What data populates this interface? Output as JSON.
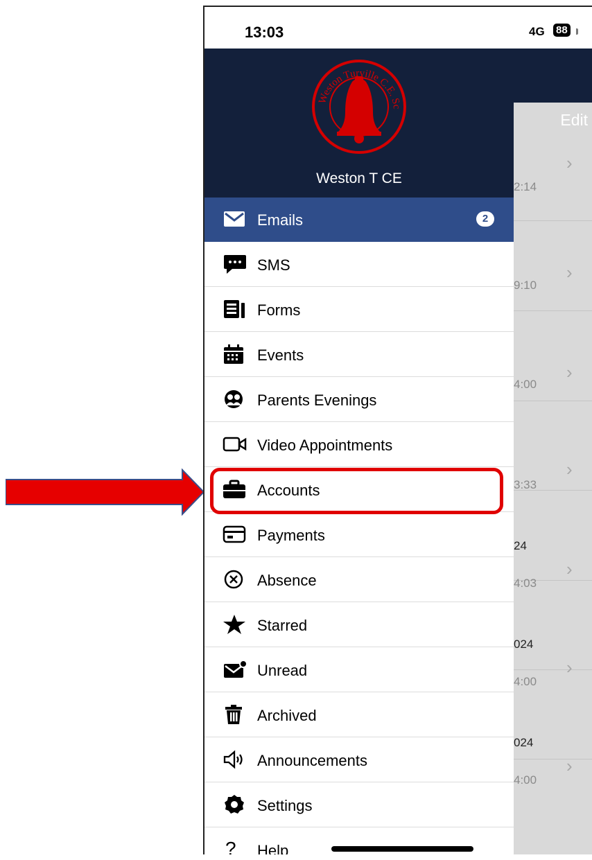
{
  "status_bar": {
    "time": "13:03",
    "network": "4G",
    "battery": "88"
  },
  "background_screen": {
    "edit_label": "Edit",
    "rows": [
      {
        "date": "",
        "time": "2:14"
      },
      {
        "date": "",
        "time": "9:10"
      },
      {
        "date": "",
        "time": "4:00"
      },
      {
        "date": "",
        "time": "3:33"
      },
      {
        "date": "24",
        "time": "4:03"
      },
      {
        "date": "024",
        "time": "4:00"
      },
      {
        "date": "024",
        "time": "4:00"
      }
    ],
    "chevron": "›"
  },
  "drawer": {
    "school_name": "Weston T CE",
    "logo_text": "Weston Turville C.E. School",
    "items": [
      {
        "label": "Emails",
        "icon": "mail-icon",
        "badge": "2",
        "active": true
      },
      {
        "label": "SMS",
        "icon": "chat-bubble-icon"
      },
      {
        "label": "Forms",
        "icon": "form-icon"
      },
      {
        "label": "Events",
        "icon": "calendar-icon"
      },
      {
        "label": "Parents Evenings",
        "icon": "people-icon"
      },
      {
        "label": "Video Appointments",
        "icon": "video-camera-icon"
      },
      {
        "label": "Accounts",
        "icon": "briefcase-icon"
      },
      {
        "label": "Payments",
        "icon": "credit-card-icon"
      },
      {
        "label": "Absence",
        "icon": "x-circle-icon"
      },
      {
        "label": "Starred",
        "icon": "star-icon"
      },
      {
        "label": "Unread",
        "icon": "unread-mail-icon"
      },
      {
        "label": "Archived",
        "icon": "trash-icon"
      },
      {
        "label": "Announcements",
        "icon": "speaker-icon"
      },
      {
        "label": "Settings",
        "icon": "gear-icon"
      },
      {
        "label": "Help",
        "icon": "question-icon"
      }
    ]
  },
  "colors": {
    "header": "#13203b",
    "active_item": "#2f4d8a",
    "logo_red": "#d40000",
    "annotation_red": "#e00000"
  }
}
